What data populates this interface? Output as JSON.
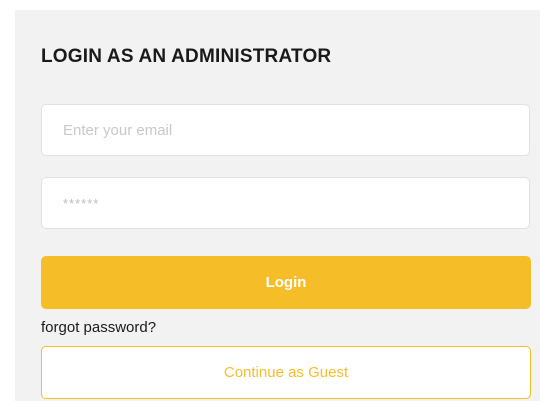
{
  "login_form": {
    "title": "LOGIN AS AN ADMINISTRATOR",
    "email_placeholder": "Enter your email",
    "password_placeholder": "******",
    "login_label": "Login",
    "forgot_label": "forgot password?",
    "guest_label": "Continue as Guest"
  },
  "colors": {
    "accent": "#f5bd28",
    "panel_background": "#f2f2f2",
    "field_background": "#ffffff",
    "field_border": "#e1e1e1",
    "text": "#1a1a1a"
  }
}
